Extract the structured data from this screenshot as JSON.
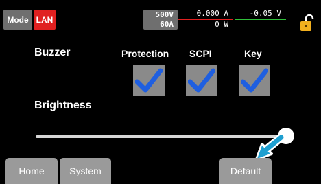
{
  "status": {
    "mode_label": "Mode",
    "interface_label": "LAN",
    "rated_voltage": "500V",
    "rated_current": "60A",
    "current_reading": "0.000 A",
    "voltage_reading": "-0.05 V",
    "power_reading": "0 W"
  },
  "settings": {
    "buzzer_label": "Buzzer",
    "brightness_label": "Brightness",
    "options": [
      {
        "label": "Protection",
        "checked": true
      },
      {
        "label": "SCPI",
        "checked": true
      },
      {
        "label": "Key",
        "checked": true
      }
    ]
  },
  "buttons": {
    "home": "Home",
    "system": "System",
    "default": "Default"
  },
  "colors": {
    "interface_tag": "#e02020",
    "current_line": "#e02020",
    "voltage_line": "#2fbf3a",
    "lock_icon": "#f2b01e",
    "checkmark": "#1f5fe0",
    "pointer_arrow": "#1e9fd0"
  }
}
